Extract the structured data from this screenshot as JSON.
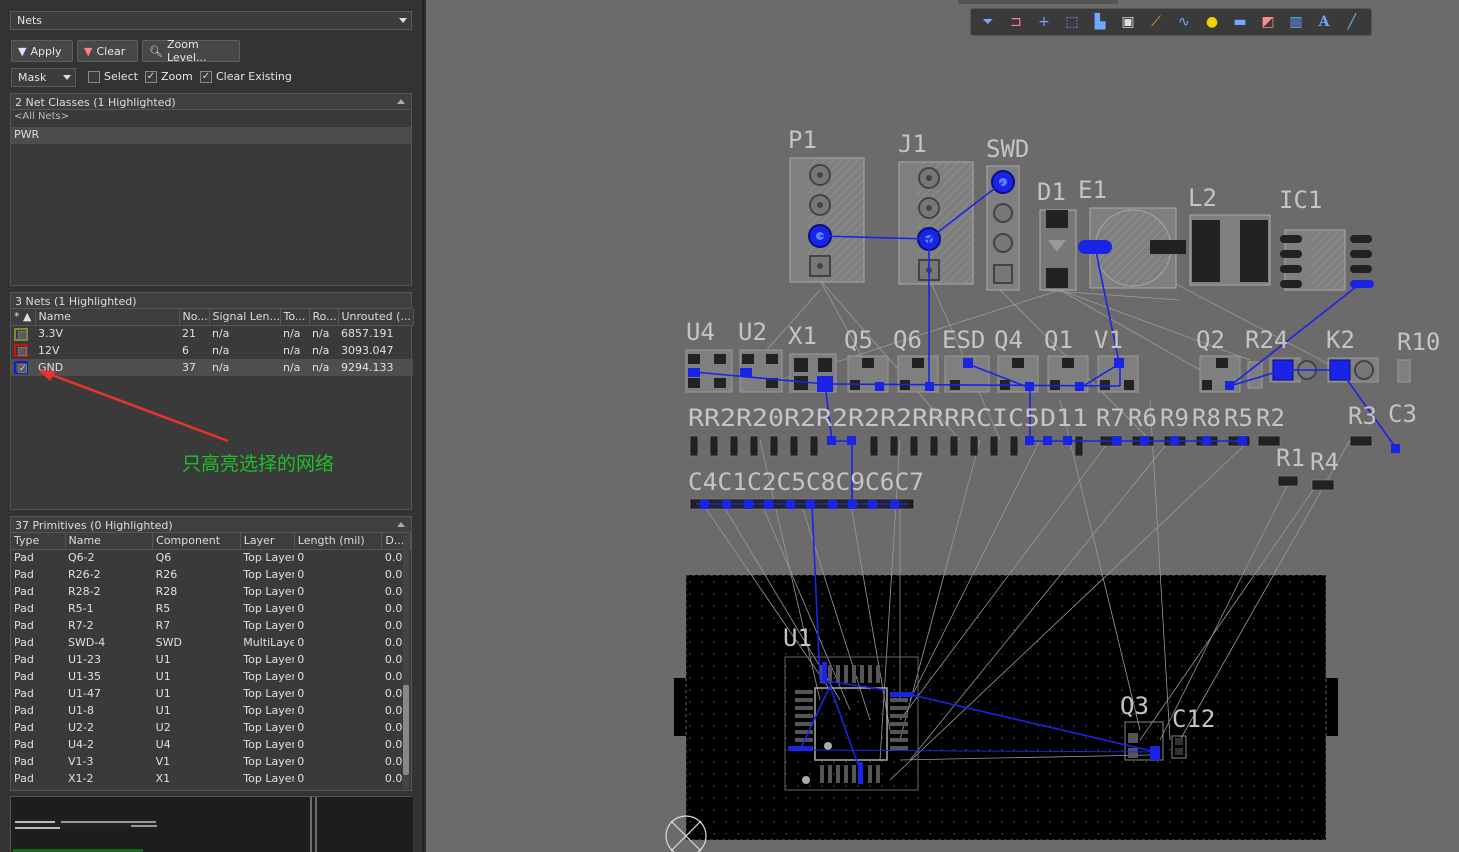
{
  "panel": {
    "mode_select": "Nets",
    "apply_label": "Apply",
    "clear_label": "Clear",
    "zoom_level_label": "Zoom Level...",
    "mask_select": "Mask",
    "select_label": "Select",
    "zoom_label": "Zoom",
    "clear_existing_label": "Clear Existing"
  },
  "net_classes": {
    "header": "2 Net Classes (1 Highlighted)",
    "items": [
      "<All Nets>",
      "PWR"
    ]
  },
  "nets": {
    "header": "3 Nets (1 Highlighted)",
    "columns": [
      "Name",
      "No...",
      "Signal Len...",
      "To...",
      "Ro...",
      "Unrouted (..."
    ],
    "rows": [
      {
        "name": "3.3V",
        "nodes": "21",
        "signal_len": "n/a",
        "to": "n/a",
        "ro": "n/a",
        "unrouted": "6857.191",
        "color": "#8a8a2a",
        "checked": ""
      },
      {
        "name": "12V",
        "nodes": "6",
        "signal_len": "n/a",
        "to": "n/a",
        "ro": "n/a",
        "unrouted": "3093.047",
        "color": "#d01010",
        "checked": ""
      },
      {
        "name": "GND",
        "nodes": "37",
        "signal_len": "n/a",
        "to": "n/a",
        "ro": "n/a",
        "unrouted": "9294.133",
        "color": "#1020d0",
        "checked": "✓"
      }
    ]
  },
  "annotation": {
    "text": "只高亮选择的网络"
  },
  "primitives": {
    "header": "37 Primitives (0 Highlighted)",
    "columns": [
      "Type",
      "Name",
      "Component",
      "Layer",
      "Length (mil)",
      "D..."
    ],
    "rows": [
      {
        "type": "Pad",
        "name": "Q6-2",
        "component": "Q6",
        "layer": "Top Layer",
        "length": "0",
        "d": "0.0("
      },
      {
        "type": "Pad",
        "name": "R26-2",
        "component": "R26",
        "layer": "Top Layer",
        "length": "0",
        "d": "0.0("
      },
      {
        "type": "Pad",
        "name": "R28-2",
        "component": "R28",
        "layer": "Top Layer",
        "length": "0",
        "d": "0.0("
      },
      {
        "type": "Pad",
        "name": "R5-1",
        "component": "R5",
        "layer": "Top Layer",
        "length": "0",
        "d": "0.0("
      },
      {
        "type": "Pad",
        "name": "R7-2",
        "component": "R7",
        "layer": "Top Layer",
        "length": "0",
        "d": "0.0("
      },
      {
        "type": "Pad",
        "name": "SWD-4",
        "component": "SWD",
        "layer": "MultiLaye",
        "length": "0",
        "d": "0.0("
      },
      {
        "type": "Pad",
        "name": "U1-23",
        "component": "U1",
        "layer": "Top Layer",
        "length": "0",
        "d": "0.0("
      },
      {
        "type": "Pad",
        "name": "U1-35",
        "component": "U1",
        "layer": "Top Layer",
        "length": "0",
        "d": "0.0("
      },
      {
        "type": "Pad",
        "name": "U1-47",
        "component": "U1",
        "layer": "Top Layer",
        "length": "0",
        "d": "0.0("
      },
      {
        "type": "Pad",
        "name": "U1-8",
        "component": "U1",
        "layer": "Top Layer",
        "length": "0",
        "d": "0.0("
      },
      {
        "type": "Pad",
        "name": "U2-2",
        "component": "U2",
        "layer": "Top Layer",
        "length": "0",
        "d": "0.0("
      },
      {
        "type": "Pad",
        "name": "U4-2",
        "component": "U4",
        "layer": "Top Layer",
        "length": "0",
        "d": "0.0("
      },
      {
        "type": "Pad",
        "name": "V1-3",
        "component": "V1",
        "layer": "Top Layer",
        "length": "0",
        "d": "0.0("
      },
      {
        "type": "Pad",
        "name": "X1-2",
        "component": "X1",
        "layer": "Top Layer",
        "length": "0",
        "d": "0.0("
      }
    ]
  },
  "pcb": {
    "designators": {
      "p1": "P1",
      "j1": "J1",
      "swd": "SWD",
      "d1": "D1",
      "e1": "E1",
      "l2": "L2",
      "ic1": "IC1",
      "u4": "U4",
      "u2": "U2",
      "x1": "X1",
      "q5": "Q5",
      "q6": "Q6",
      "esd": "ESD",
      "q4": "Q4",
      "q1": "Q1",
      "v1": "V1",
      "q2": "Q2",
      "r24": "R24",
      "k2": "K2",
      "r10": "R10",
      "rrow": "RR2R20R2R2R2R2RRRRCIC5D11",
      "r7": "R7",
      "r6": "R6",
      "r9": "R9",
      "r8": "R8",
      "r5": "R5",
      "r2": "R2",
      "r3": "R3",
      "c3": "C3",
      "r1": "R1",
      "r4": "R4",
      "crow": "C4C1C2C5C8C9C6C7",
      "u1": "U1",
      "q3": "Q3",
      "c12": "C12"
    },
    "highlight_color": "#1a24e6",
    "board_color": "#000000"
  },
  "toolbar_icons": [
    "filter-icon",
    "route-icon",
    "cross-icon",
    "select-rect-icon",
    "chart-icon",
    "component-icon",
    "net-icon",
    "wave-icon",
    "bulb-icon",
    "layer-icon",
    "graph-icon",
    "stats-icon",
    "text-icon",
    "line-icon"
  ]
}
